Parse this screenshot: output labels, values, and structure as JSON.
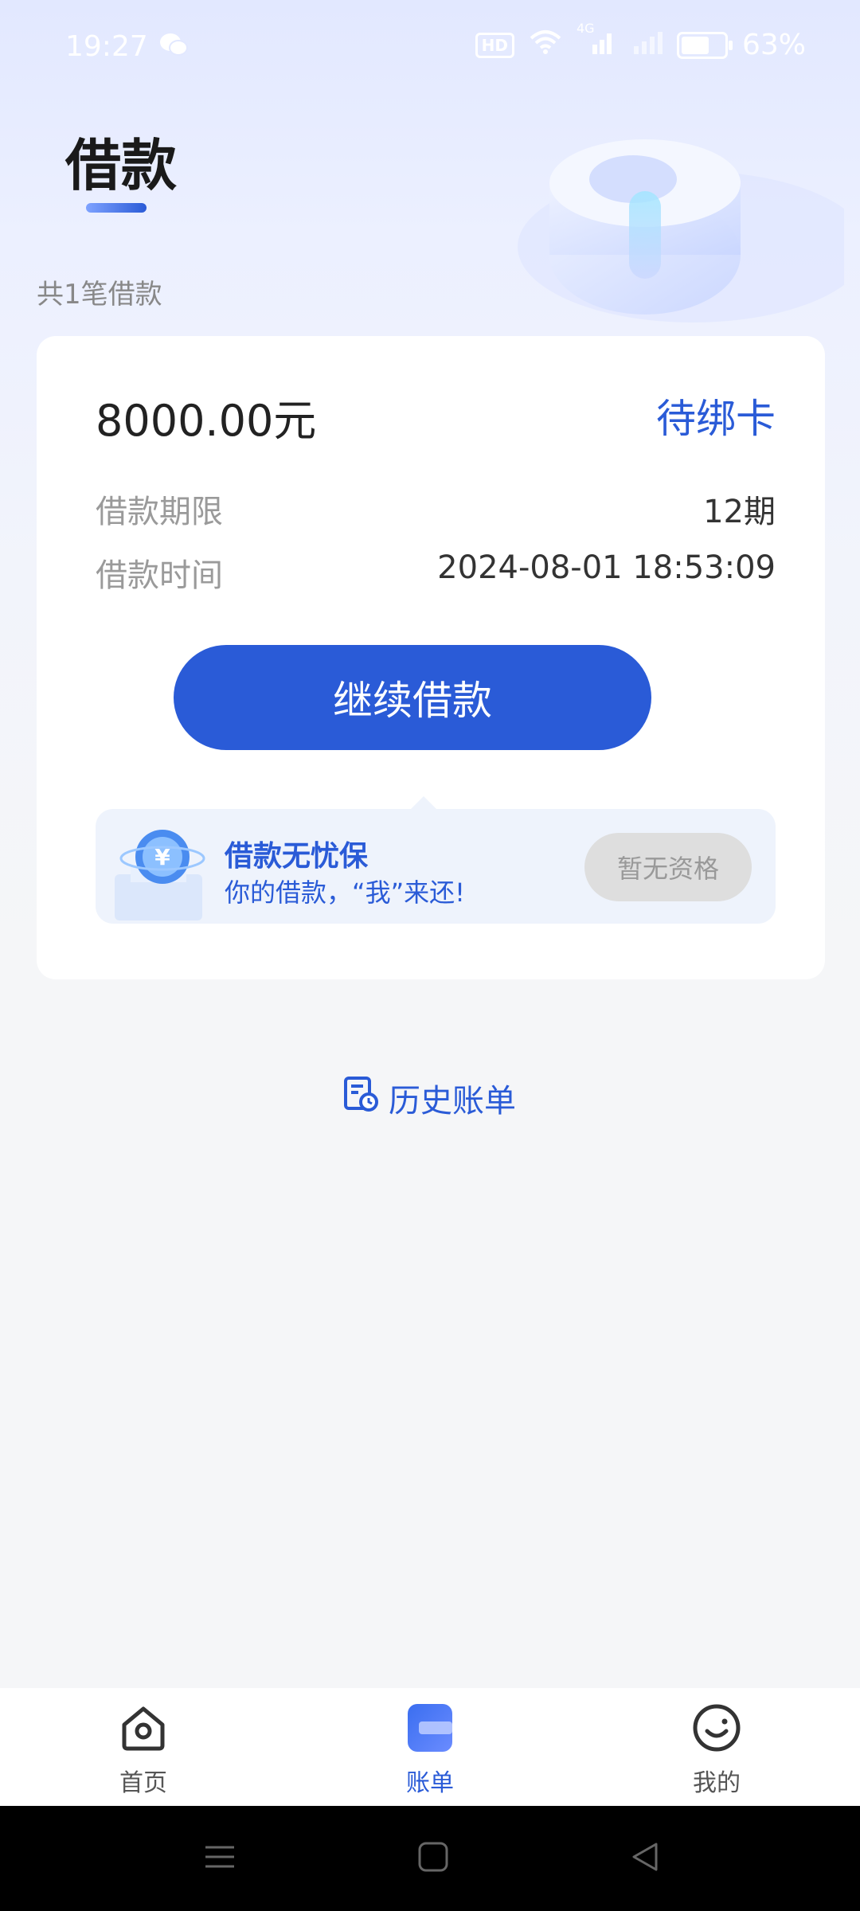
{
  "status_bar": {
    "time": "19:27",
    "hd": "HD",
    "network": "4G",
    "battery": "63%"
  },
  "page": {
    "title": "借款",
    "loan_count": "共1笔借款"
  },
  "loan_card": {
    "amount": "8000.00元",
    "status": "待绑卡",
    "term_label": "借款期限",
    "term_value": "12期",
    "time_label": "借款时间",
    "time_value": "2024-08-01 18:53:09",
    "cta_label": "继续借款"
  },
  "promo": {
    "title": "借款无忧保",
    "subtitle": "你的借款，“我”来还!",
    "button_label": "暂无资格"
  },
  "history_link": "历史账单",
  "tabs": [
    {
      "label": "首页",
      "icon": "home-icon"
    },
    {
      "label": "账单",
      "icon": "bill-icon",
      "active": true
    },
    {
      "label": "我的",
      "icon": "profile-icon"
    }
  ],
  "colors": {
    "accent": "#2a5bd7",
    "page_bg": "#f5f6f8"
  }
}
